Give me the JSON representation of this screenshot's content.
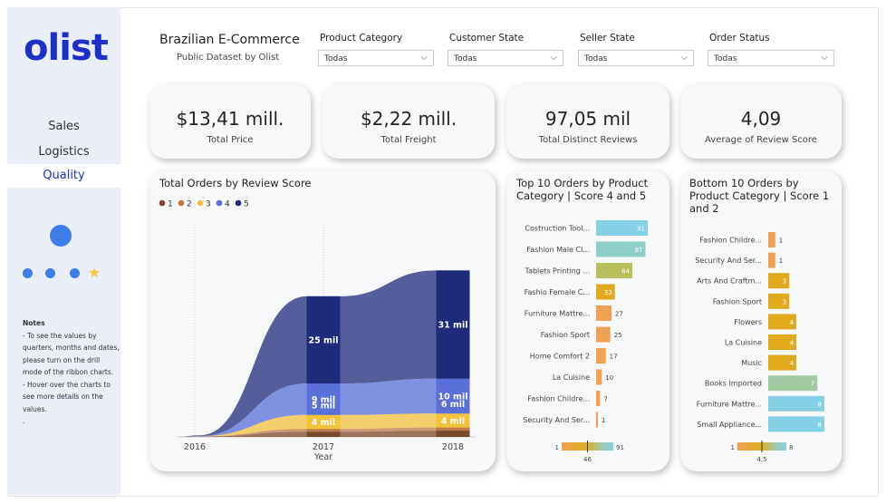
{
  "app": {
    "logo": "olist"
  },
  "sidebar": {
    "items": [
      {
        "label": "Sales",
        "active": false
      },
      {
        "label": "Logistics",
        "active": false
      },
      {
        "label": "Quality",
        "active": true
      }
    ],
    "notes_title": "Notes",
    "notes_lines": [
      "- To see the values by",
      "quarters, months and dates,",
      "please turn on the drill",
      "mode of the ribbon charts.",
      "- Hover over the charts to",
      "see more details on the",
      "values.",
      "."
    ]
  },
  "header": {
    "title": "Brazilian E-Commerce",
    "subtitle": "Public Dataset by Olist"
  },
  "filters": [
    {
      "label": "Product Category",
      "value": "Todas"
    },
    {
      "label": "Customer State",
      "value": "Todas"
    },
    {
      "label": "Seller State",
      "value": "Todas"
    },
    {
      "label": "Order Status",
      "value": "Todas"
    }
  ],
  "kpis": [
    {
      "value": "$13,41 mill.",
      "label": "Total Price"
    },
    {
      "value": "$2,22 mill.",
      "label": "Total Freight"
    },
    {
      "value": "97,05 mil",
      "label": "Total Distinct Reviews"
    },
    {
      "value": "4,09",
      "label": "Average of Review Score"
    }
  ],
  "colors": {
    "accent": "#1c30c8",
    "score_1": "#7b4a2a",
    "score_2": "#c07a48",
    "score_3": "#f2c23b",
    "score_4": "#5a6fd8",
    "score_5": "#1f2a7a",
    "cyan": "#86d0e6",
    "teal": "#8fcfc8",
    "olive": "#b9c05a",
    "gold": "#e0a91e",
    "orange": "#f0a050",
    "green": "#a3c9a3"
  },
  "chart_data": [
    {
      "type": "area",
      "title": "Total Orders by Review Score",
      "xlabel": "Year",
      "ylabel": "",
      "categories": [
        "2016",
        "2017",
        "2018"
      ],
      "legend_position": "top-left",
      "series": [
        {
          "name": "1",
          "values": [
            0.1,
            1.5,
            1.8
          ],
          "color": "#7b4a2a"
        },
        {
          "name": "2",
          "values": [
            0.05,
            0.8,
            0.9
          ],
          "color": "#c07a48"
        },
        {
          "name": "3",
          "values": [
            0.05,
            4,
            4
          ],
          "color": "#f2c23b"
        },
        {
          "name": "4",
          "values": [
            0.1,
            9,
            10
          ],
          "color": "#5a6fd8"
        },
        {
          "name": "5",
          "values": [
            0.2,
            25,
            31
          ],
          "color": "#1f2a7a"
        }
      ],
      "data_labels": {
        "2017": {
          "3": "4 mil",
          "1": "5 mil",
          "4": "9 mil",
          "5": "25 mil"
        },
        "2018": {
          "3": "4 mil",
          "1": "6 mil",
          "4": "10 mil",
          "5": "31 mil"
        }
      },
      "grid": false
    },
    {
      "type": "bar",
      "title": "Top 10 Orders by Product Category | Score 4 and 5",
      "orientation": "horizontal",
      "categories": [
        "Costruction Tool...",
        "Fashion Male Cl...",
        "Tablets Printing ...",
        "Fashio Female C...",
        "Furniture Mattre...",
        "Fashion Sport",
        "Home Comfort 2",
        "La Cuisine",
        "Fashion Childre...",
        "Security And Ser..."
      ],
      "values": [
        91,
        87,
        64,
        33,
        27,
        25,
        17,
        10,
        7,
        1
      ],
      "colors": [
        "#86d0e6",
        "#8fcfc8",
        "#b9c05a",
        "#e0a91e",
        "#f0a050",
        "#f0a050",
        "#f0a050",
        "#f0a050",
        "#f0a050",
        "#f0a050"
      ],
      "scale": {
        "min": "1",
        "max": "91",
        "mid": "46"
      }
    },
    {
      "type": "bar",
      "title": "Bottom 10 Orders by Product Category | Score 1 and 2",
      "orientation": "horizontal",
      "categories": [
        "Fashion Childre...",
        "Security And Ser...",
        "Arts And Craftm...",
        "Fashion Sport",
        "Flowers",
        "La Cuisine",
        "Music",
        "Books Imported",
        "Furniture Mattre...",
        "Small Appliance..."
      ],
      "values": [
        1,
        1,
        3,
        3,
        4,
        4,
        4,
        7,
        8,
        8
      ],
      "colors": [
        "#f0a050",
        "#f0a050",
        "#e0a91e",
        "#e0a91e",
        "#e0a91e",
        "#e0a91e",
        "#e0a91e",
        "#a3c9a3",
        "#86d0e6",
        "#86d0e6"
      ],
      "scale": {
        "min": "1",
        "max": "8",
        "mid": "4,5"
      }
    }
  ]
}
